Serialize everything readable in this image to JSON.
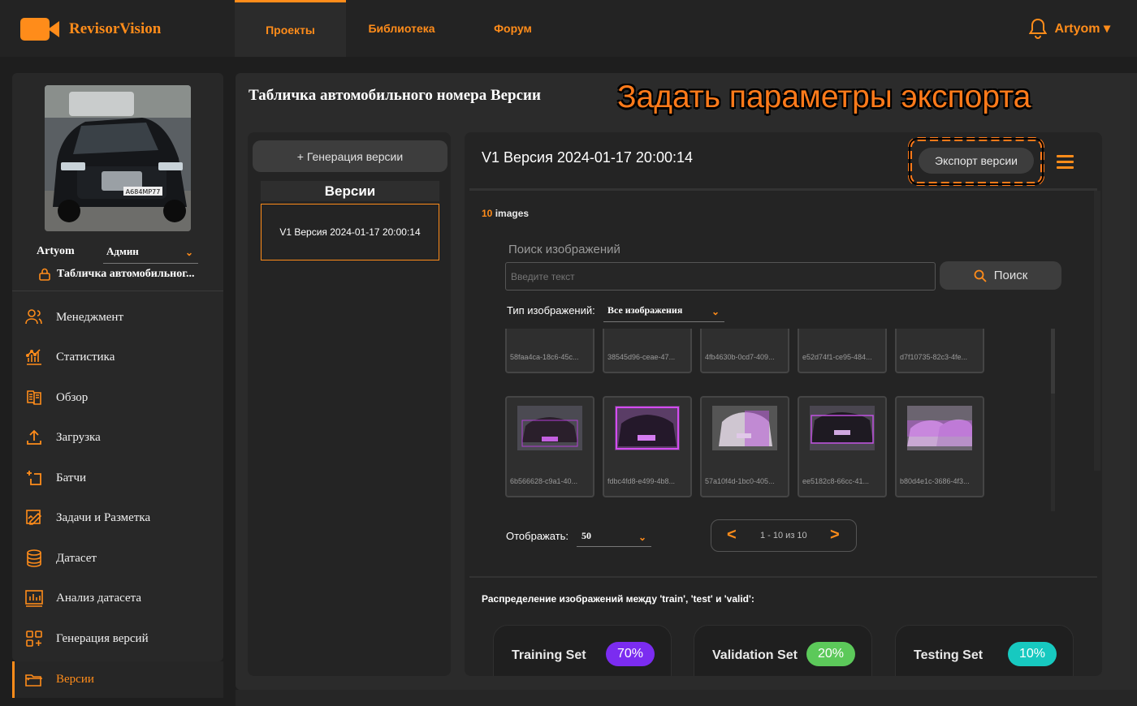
{
  "app": {
    "name": "RevisorVision"
  },
  "nav": {
    "tabs": [
      {
        "label": "Проекты"
      },
      {
        "label": "Библиотека"
      },
      {
        "label": "Форум"
      }
    ]
  },
  "user": {
    "name": "Artyom",
    "top_label": "Artyom ▾",
    "role": "Админ",
    "project": "Табличка автомобильног..."
  },
  "sidebar": {
    "items": [
      {
        "label": "Менеджмент",
        "icon": "users-icon"
      },
      {
        "label": "Статистика",
        "icon": "chart-icon"
      },
      {
        "label": "Обзор",
        "icon": "book-icon"
      },
      {
        "label": "Загрузка",
        "icon": "upload-icon"
      },
      {
        "label": "Батчи",
        "icon": "batch-icon"
      },
      {
        "label": "Задачи и Разметка",
        "icon": "annotate-icon"
      },
      {
        "label": "Датасет",
        "icon": "database-icon"
      },
      {
        "label": "Анализ датасета",
        "icon": "analytics-icon"
      },
      {
        "label": "Генерация версий",
        "icon": "grid-plus-icon"
      },
      {
        "label": "Версии",
        "icon": "folder-icon"
      }
    ],
    "active_index": 9
  },
  "page": {
    "title": "Табличка автомобильного номера Версии",
    "annotation": "Задать параметры экспорта"
  },
  "versions_panel": {
    "generate_label": "+ Генерация версии",
    "header": "Версии",
    "items": [
      {
        "label": "V1  Версия 2024-01-17 20:00:14"
      }
    ]
  },
  "version_detail": {
    "title": "V1 Версия 2024-01-17 20:00:14",
    "export_label": "Экспорт версии",
    "image_count": "10",
    "image_count_suffix": " images",
    "search": {
      "label": "Поиск изображений",
      "placeholder": "Введите текст",
      "button": "Поиск"
    },
    "type_filter": {
      "label": "Тип изображений:",
      "value": "Все изображения"
    },
    "thumbnails_row1": [
      {
        "caption": "58faa4ca-18c6-45c..."
      },
      {
        "caption": "38545d96-ceae-47..."
      },
      {
        "caption": "4fb4630b-0cd7-409..."
      },
      {
        "caption": "e52d74f1-ce95-484..."
      },
      {
        "caption": "d7f10735-82c3-4fe..."
      }
    ],
    "thumbnails_row2": [
      {
        "caption": "6b566628-c9a1-40..."
      },
      {
        "caption": "fdbc4fd8-e499-4b8..."
      },
      {
        "caption": "57a10f4d-1bc0-405..."
      },
      {
        "caption": "ee5182c8-66cc-41..."
      },
      {
        "caption": "b80d4e1c-3686-4f3..."
      }
    ],
    "page_size": {
      "label": "Отображать:",
      "value": "50"
    },
    "pager": {
      "prev": "<",
      "next": ">",
      "info": "1 - 10 из 10"
    },
    "distribution": {
      "label": "Распределение изображений между 'train', 'test' и 'valid':",
      "sets": [
        {
          "name": "Training Set",
          "percent": "70%",
          "color": "#7b2cf0"
        },
        {
          "name": "Validation Set",
          "percent": "20%",
          "color": "#5cc95a"
        },
        {
          "name": "Testing Set",
          "percent": "10%",
          "color": "#17c9c0"
        }
      ]
    }
  },
  "colors": {
    "accent": "#ff8c1a",
    "background": "#1e1e1e",
    "panel": "#242424"
  }
}
